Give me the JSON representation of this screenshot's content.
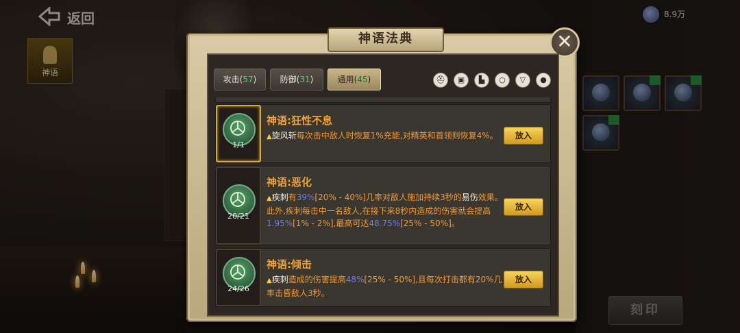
{
  "topbar": {
    "back_label": "返回",
    "currency_value": "8.9万"
  },
  "side_tab": {
    "label": "神语"
  },
  "engrave_button": "刻印",
  "modal": {
    "title": "神语法典",
    "close_symbol": "✕",
    "tabs": [
      {
        "label": "攻击",
        "count": "57",
        "active": false
      },
      {
        "label": "防御",
        "count": "31",
        "active": false
      },
      {
        "label": "通用",
        "count": "45",
        "active": true
      }
    ],
    "filter_icons": [
      "helmet-icon",
      "armor-icon",
      "boots-icon",
      "ring-icon",
      "necklace-icon",
      "amulet-icon"
    ],
    "entries": [
      {
        "title": "神语:狂性不息",
        "count": "1/1",
        "selected": true,
        "desc_parts": [
          {
            "t": "旋风斩",
            "c": "kw"
          },
          {
            "t": "每次击中敌人时恢复1%充能,对精英和首领则恢复4%。",
            "c": ""
          }
        ],
        "button": "放入"
      },
      {
        "title": "神语:恶化",
        "count": "20/21",
        "selected": false,
        "desc_parts": [
          {
            "t": "疾刺",
            "c": "kw"
          },
          {
            "t": "有",
            "c": ""
          },
          {
            "t": "39%",
            "c": "hl"
          },
          {
            "t": "[20% - 40%]几率对敌人施加持续3秒的",
            "c": ""
          },
          {
            "t": "易伤",
            "c": "kw"
          },
          {
            "t": "效果。此外,疾刺每击中一名敌人,在接下来8秒内造成的伤害就会提高",
            "c": ""
          },
          {
            "t": "1.95%",
            "c": "hl"
          },
          {
            "t": "[1% - 2%],最高可达",
            "c": ""
          },
          {
            "t": "48.75%",
            "c": "hl"
          },
          {
            "t": "[25% - 50%]。",
            "c": ""
          }
        ],
        "button": "放入"
      },
      {
        "title": "神语:倾击",
        "count": "24/26",
        "selected": false,
        "desc_parts": [
          {
            "t": "疾刺",
            "c": "kw"
          },
          {
            "t": "造成的伤害提高",
            "c": ""
          },
          {
            "t": "48%",
            "c": "hl"
          },
          {
            "t": "[25% - 50%],且每次打击都有20%几率击昏敌人3秒。",
            "c": ""
          }
        ],
        "button": "放入"
      }
    ]
  }
}
